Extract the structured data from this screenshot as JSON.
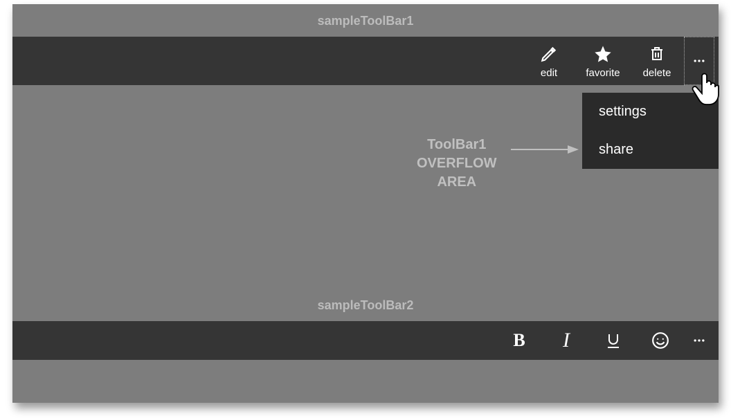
{
  "section1": {
    "title": "sampleToolBar1"
  },
  "section2": {
    "title": "sampleToolBar2"
  },
  "toolbar1": {
    "edit": "edit",
    "favorite": "favorite",
    "delete": "delete"
  },
  "overflow": {
    "settings": "settings",
    "share": "share"
  },
  "annotation": {
    "line1": "ToolBar1",
    "line2": "OVERFLOW",
    "line3": "AREA"
  }
}
